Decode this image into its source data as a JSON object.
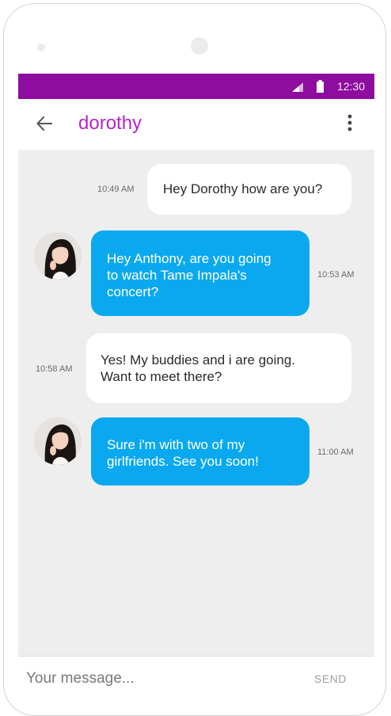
{
  "status": {
    "time": "12:30",
    "signal_icon": "cell-signal-icon",
    "battery_icon": "battery-icon"
  },
  "header": {
    "back_icon": "arrow-left-icon",
    "contact_name": "dorothy",
    "menu_icon": "more-vert-icon"
  },
  "messages": [
    {
      "sender": "me",
      "time": "10:49 AM",
      "text": "Hey Dorothy how are you?"
    },
    {
      "sender": "dorothy",
      "time": "10:53 AM",
      "lines": [
        "Hey Anthony, are you going",
        "to watch Tame Impala's",
        "concert?"
      ]
    },
    {
      "sender": "me",
      "time": "10:58 AM",
      "lines": [
        "Yes! My buddies and i are going.",
        "Want to meet there?"
      ]
    },
    {
      "sender": "dorothy",
      "time": "11:00 AM",
      "lines": [
        "Sure i'm with two of my",
        "girlfriends. See you soon!"
      ]
    }
  ],
  "composer": {
    "placeholder": "Your message...",
    "send_label": "SEND"
  },
  "colors": {
    "status_bar": "#8e0c9e",
    "contact_name": "#b427c8",
    "incoming_bubble": "#0aa9ef",
    "outgoing_bubble": "#ffffff",
    "chat_background": "#eeeeee"
  }
}
